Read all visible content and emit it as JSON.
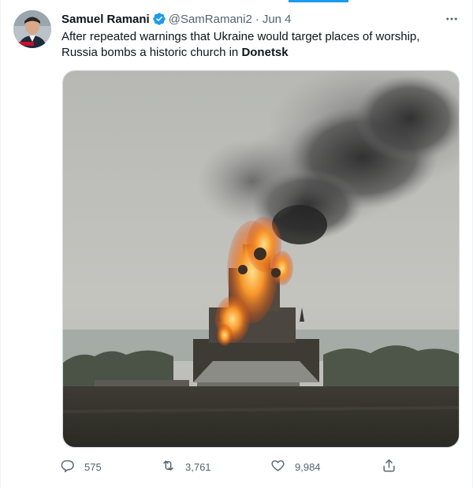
{
  "tweet": {
    "author": {
      "display_name": "Samuel Ramani",
      "handle": "@SamRamani2",
      "verified": true
    },
    "separator": "·",
    "timestamp": "Jun 4",
    "text_before": "After repeated warnings that Ukraine would target places of worship, Russia bombs a historic church in ",
    "text_link": "Donetsk",
    "stats": {
      "replies": "575",
      "retweets": "3,761",
      "likes": "9,984"
    }
  },
  "icons": {
    "verified": "verified-badge-icon",
    "more": "more-horizontal-icon",
    "reply": "reply-icon",
    "retweet": "retweet-icon",
    "like": "heart-icon",
    "share": "share-icon"
  },
  "colors": {
    "accent": "#1d9bf0",
    "text": "#0f1419",
    "secondary": "#536471",
    "border": "#cfd9de",
    "fire": "#f06a1c",
    "smoke": "#3a3a3a"
  }
}
